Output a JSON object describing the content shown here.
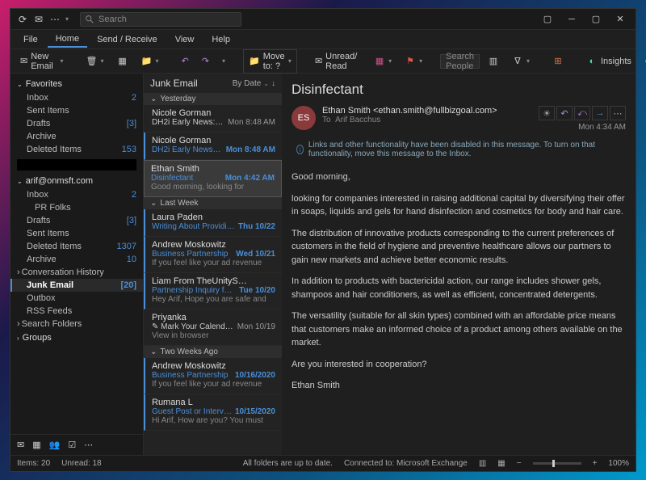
{
  "titlebar": {
    "search_placeholder": "Search"
  },
  "menus": [
    "File",
    "Home",
    "Send / Receive",
    "View",
    "Help"
  ],
  "active_menu": 1,
  "ribbon": {
    "new_email": "New Email",
    "move_to": "Move to: ?",
    "unread_read": "Unread/ Read",
    "search_people": "Search People",
    "insights": "Insights"
  },
  "nav": {
    "favorites": {
      "label": "Favorites",
      "items": [
        {
          "label": "Inbox",
          "count": "2"
        },
        {
          "label": "Sent Items",
          "count": ""
        },
        {
          "label": "Drafts",
          "count": "[3]"
        },
        {
          "label": "Archive",
          "count": ""
        },
        {
          "label": "Deleted Items",
          "count": "153"
        }
      ]
    },
    "account_label": "arif@onmsft.com",
    "account": [
      {
        "label": "Inbox",
        "count": "2",
        "sub": false
      },
      {
        "label": "PR Folks",
        "count": "",
        "sub": true
      },
      {
        "label": "Drafts",
        "count": "[3]",
        "sub": false
      },
      {
        "label": "Sent Items",
        "count": "",
        "sub": false
      },
      {
        "label": "Deleted Items",
        "count": "1307",
        "sub": false
      },
      {
        "label": "Archive",
        "count": "10",
        "sub": false
      },
      {
        "label": "Conversation History",
        "count": "",
        "sub": false,
        "chev": true
      },
      {
        "label": "Junk Email",
        "count": "[20]",
        "sub": false,
        "sel": true
      },
      {
        "label": "Outbox",
        "count": "",
        "sub": false
      },
      {
        "label": "RSS Feeds",
        "count": "",
        "sub": false
      },
      {
        "label": "Search Folders",
        "count": "",
        "sub": false,
        "chev": true
      }
    ],
    "groups": "Groups"
  },
  "list": {
    "folder": "Junk Email",
    "sort": "By Date",
    "groups": [
      {
        "label": "Yesterday",
        "items": [
          {
            "from": "Nicole Gorman",
            "subj": "DH2i Early News: DxOdyssey f…",
            "date": "Mon 8:48 AM",
            "prev": "",
            "unread": false
          },
          {
            "from": "Nicole Gorman",
            "subj": "DH2i Early News: DxOdysse…",
            "date": "Mon 8:48 AM",
            "prev": "",
            "unread": true
          },
          {
            "from": "Ethan Smith",
            "subj": "Disinfectant",
            "date": "Mon 4:42 AM",
            "prev": "Good morning,  looking for",
            "unread": true,
            "sel": true
          }
        ]
      },
      {
        "label": "Last Week",
        "items": [
          {
            "from": "Laura Paden",
            "subj": "Writing About Providing To…",
            "date": "Thu 10/22",
            "prev": "",
            "unread": true
          },
          {
            "from": "Andrew Moskowitz",
            "subj": "Business Partnership",
            "date": "Wed 10/21",
            "prev": "If you feel like your ad revenue",
            "unread": true
          },
          {
            "from": "Liam From TheUnityS…",
            "subj": "Partnership Inquiry for Arif.",
            "date": "Tue 10/20",
            "prev": "Hey Arif,  Hope you are safe and",
            "unread": true
          },
          {
            "from": "Priyanka",
            "subj": "✎ Mark Your Calendars to M…",
            "date": "Mon 10/19",
            "prev": "View in browser",
            "unread": false
          }
        ]
      },
      {
        "label": "Two Weeks Ago",
        "items": [
          {
            "from": "Andrew Moskowitz",
            "subj": "Business Partnership",
            "date": "10/16/2020",
            "prev": "If you feel like your ad revenue",
            "unread": true
          },
          {
            "from": "Rumana L",
            "subj": "Guest Post or Interview opp…",
            "date": "10/15/2020",
            "prev": "Hi Arif,  How are you?  You must",
            "unread": true
          }
        ]
      }
    ]
  },
  "reading": {
    "subject": "Disinfectant",
    "initials": "ES",
    "from_line": "Ethan Smith <ethan.smith@fullbizgoal.com>",
    "to_label": "To",
    "to": "Arif Bacchus",
    "date": "Mon 4:34 AM",
    "info": "Links and other functionality have been disabled in this message. To turn on that functionality, move this message to the Inbox.",
    "body": [
      "Good morning,",
      "looking for companies interested in raising additional capital by diversifying their offer in soaps, liquids and gels for hand disinfection and cosmetics for body and hair care.",
      "The distribution of innovative products corresponding to the current preferences of customers in the field of hygiene and preventive healthcare allows our partners to gain new markets and achieve better economic results.",
      "In addition to products with bactericidal action, our range includes shower gels, shampoos and hair conditioners, as well as efficient, concentrated detergents.",
      "The versatility (suitable for all skin types) combined with an affordable price means that customers make an informed choice of a product among others available on the market.",
      "Are you interested in cooperation?",
      "Ethan Smith"
    ]
  },
  "status": {
    "items": "Items: 20",
    "unread": "Unread: 18",
    "sync": "All folders are up to date.",
    "conn": "Connected to: Microsoft Exchange",
    "zoom": "100%"
  }
}
